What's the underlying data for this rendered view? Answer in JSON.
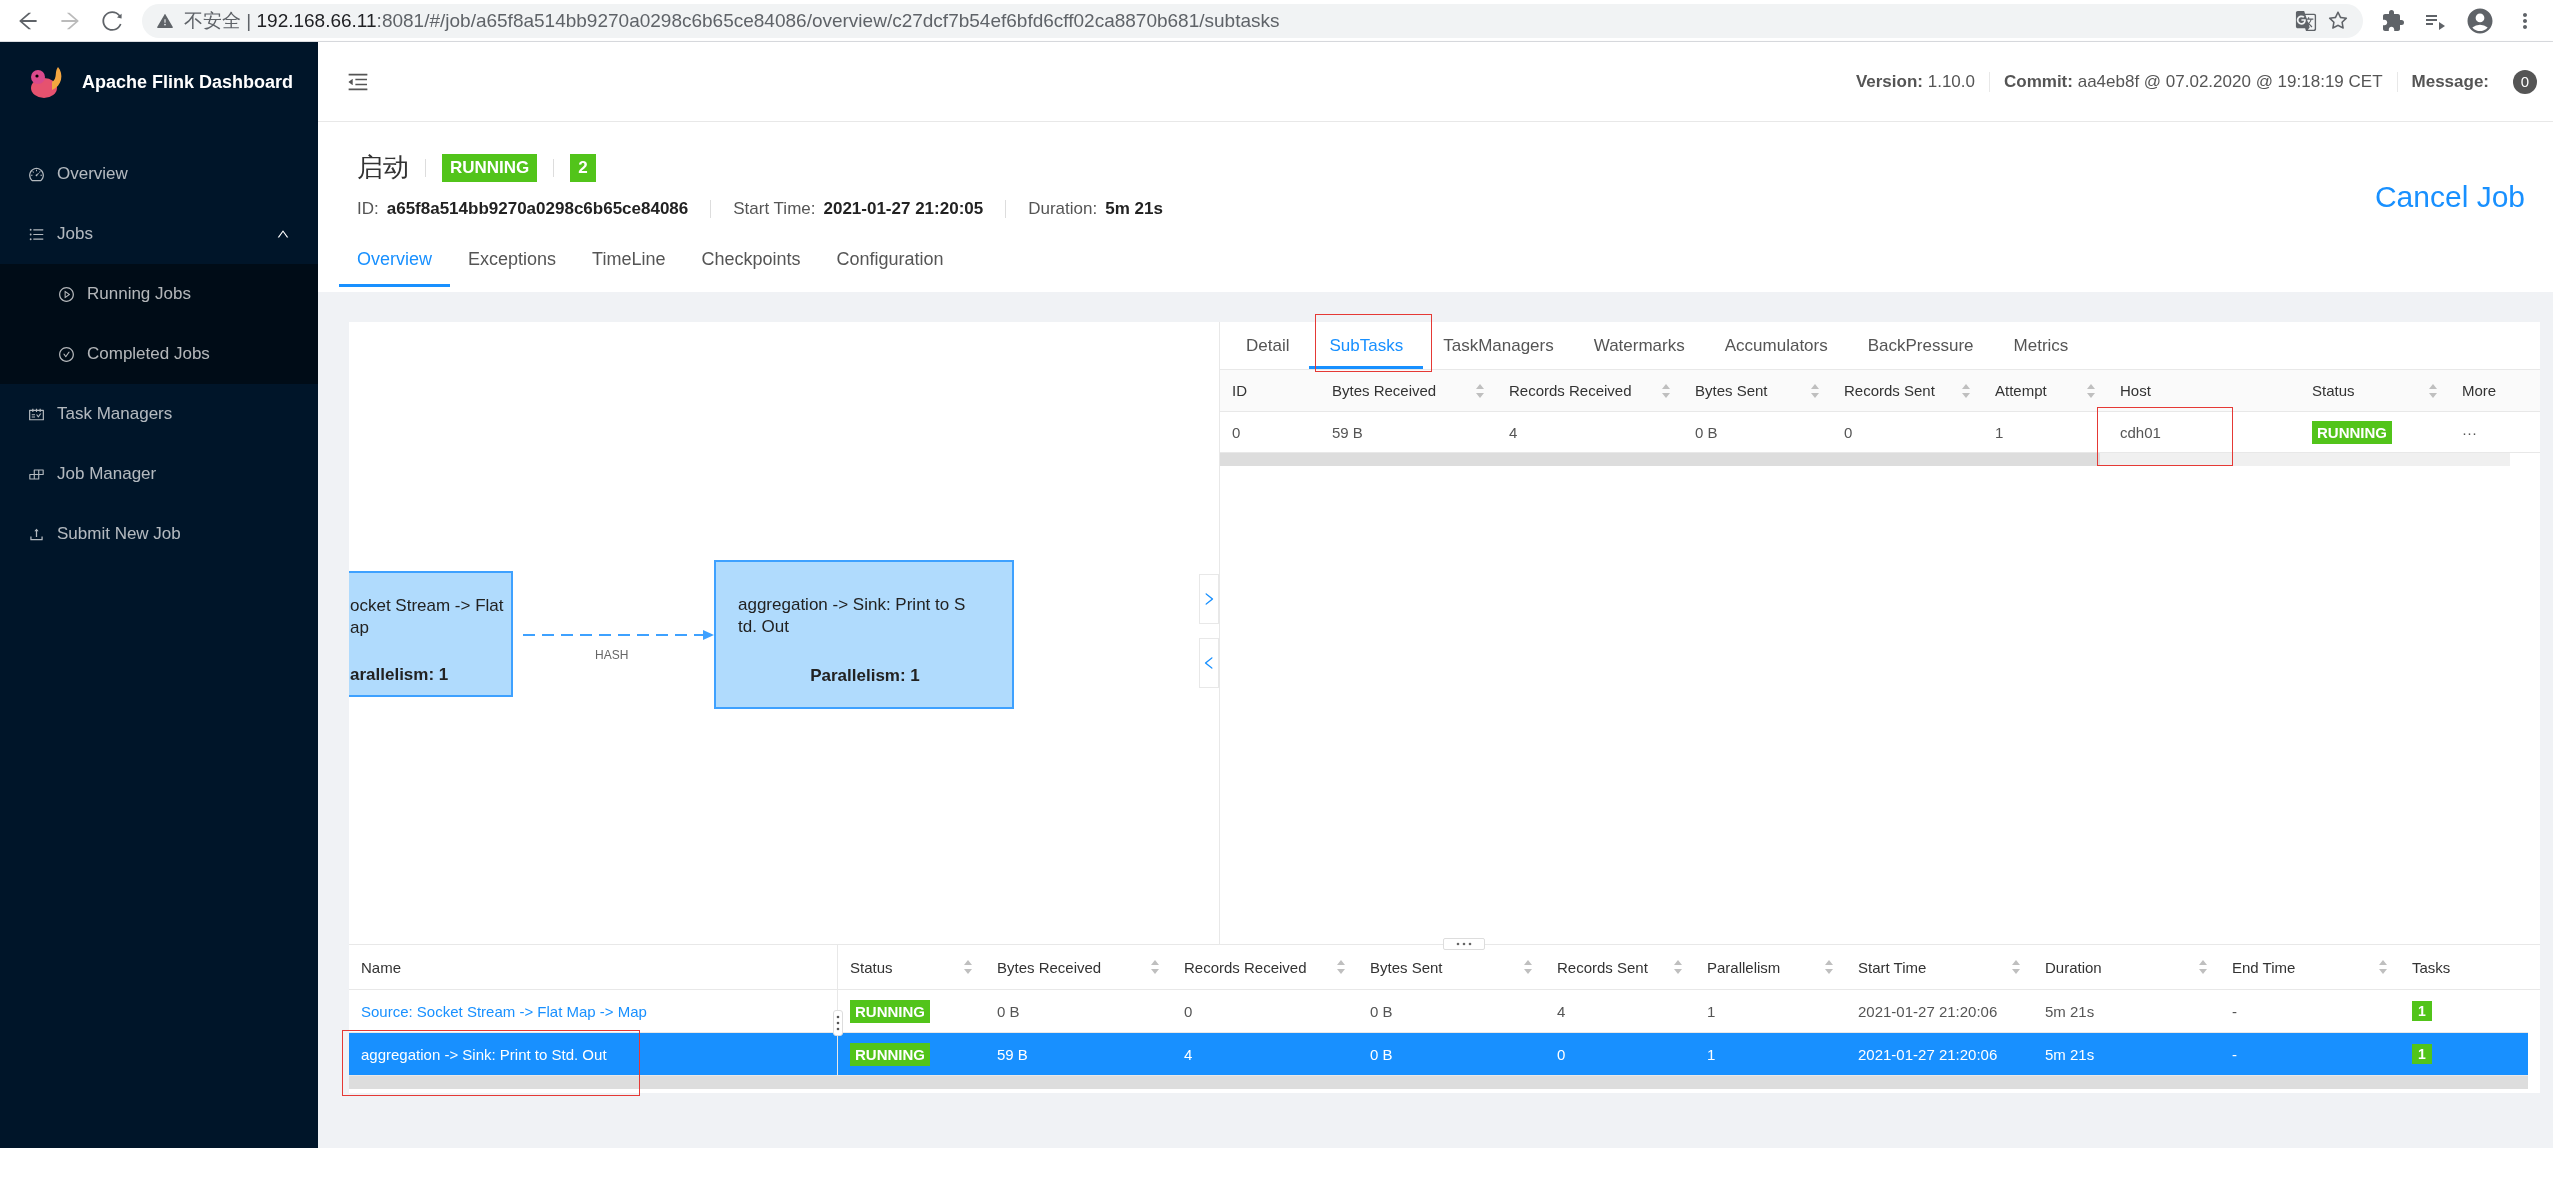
{
  "browser": {
    "security": "不安全",
    "separator": "|",
    "host": "192.168.66.11",
    "path": ":8081/#/job/a65f8a514bb9270a0298c6b65ce84086/overview/c27dcf7b54ef6bfd6cff02ca8870b681/subtasks"
  },
  "sidebar": {
    "title": "Apache Flink Dashboard",
    "items": [
      {
        "label": "Overview"
      },
      {
        "label": "Jobs",
        "expanded": true,
        "children": [
          {
            "label": "Running Jobs"
          },
          {
            "label": "Completed Jobs"
          }
        ]
      },
      {
        "label": "Task Managers"
      },
      {
        "label": "Job Manager"
      },
      {
        "label": "Submit New Job"
      }
    ]
  },
  "header": {
    "version_label": "Version:",
    "version": "1.10.0",
    "commit_label": "Commit:",
    "commit": "aa4eb8f @ 07.02.2020 @ 19:18:19 CET",
    "message_label": "Message:",
    "message_count": "0"
  },
  "job": {
    "name": "启动",
    "status": "RUNNING",
    "count": "2",
    "id_label": "ID:",
    "id": "a65f8a514bb9270a0298c6b65ce84086",
    "start_label": "Start Time:",
    "start": "2021-01-27 21:20:05",
    "duration_label": "Duration:",
    "duration": "5m 21s",
    "cancel": "Cancel Job",
    "tabs": [
      {
        "label": "Overview",
        "selected": true
      },
      {
        "label": "Exceptions",
        "selected": false
      },
      {
        "label": "TimeLine",
        "selected": false
      },
      {
        "label": "Checkpoints",
        "selected": false
      },
      {
        "label": "Configuration",
        "selected": false
      }
    ]
  },
  "graph": {
    "nodes": [
      {
        "lines": [
          "ocket Stream -> Flat",
          "ap"
        ],
        "parallelism": "arallelism: 1"
      },
      {
        "lines": [
          "aggregation -> Sink: Print to S",
          "td. Out"
        ],
        "parallelism": "Parallelism: 1"
      }
    ],
    "edge_label": "HASH"
  },
  "detail": {
    "tabs": [
      {
        "label": "Detail",
        "selected": false
      },
      {
        "label": "SubTasks",
        "selected": true
      },
      {
        "label": "TaskManagers",
        "selected": false
      },
      {
        "label": "Watermarks",
        "selected": false
      },
      {
        "label": "Accumulators",
        "selected": false
      },
      {
        "label": "BackPressure",
        "selected": false
      },
      {
        "label": "Metrics",
        "selected": false
      }
    ],
    "columns": [
      {
        "label": "ID",
        "sortable": false
      },
      {
        "label": "Bytes Received",
        "sortable": true
      },
      {
        "label": "Records Received",
        "sortable": true
      },
      {
        "label": "Bytes Sent",
        "sortable": true
      },
      {
        "label": "Records Sent",
        "sortable": true
      },
      {
        "label": "Attempt",
        "sortable": true
      },
      {
        "label": "Host",
        "sortable": false
      },
      {
        "label": "Status",
        "sortable": true
      },
      {
        "label": "More",
        "sortable": false
      }
    ],
    "rows": [
      {
        "cells": [
          "0",
          "59 B",
          "4",
          "0 B",
          "0",
          "1",
          "cdh01",
          "RUNNING",
          "···"
        ]
      }
    ]
  },
  "vertices": {
    "columns": [
      {
        "label": "Name",
        "sortable": false
      },
      {
        "label": "Status",
        "sortable": true
      },
      {
        "label": "Bytes Received",
        "sortable": true
      },
      {
        "label": "Records Received",
        "sortable": true
      },
      {
        "label": "Bytes Sent",
        "sortable": true
      },
      {
        "label": "Records Sent",
        "sortable": true
      },
      {
        "label": "Parallelism",
        "sortable": true
      },
      {
        "label": "Start Time",
        "sortable": true
      },
      {
        "label": "Duration",
        "sortable": true
      },
      {
        "label": "End Time",
        "sortable": true
      },
      {
        "label": "Tasks",
        "sortable": false
      }
    ],
    "rows": [
      {
        "cells": [
          "Source: Socket Stream -> Flat Map -> Map",
          "RUNNING",
          "0 B",
          "0",
          "0 B",
          "4",
          "1",
          "2021-01-27 21:20:06",
          "5m 21s",
          "-",
          "1"
        ],
        "selected": false
      },
      {
        "cells": [
          "aggregation -> Sink: Print to Std. Out",
          "RUNNING",
          "59 B",
          "4",
          "0 B",
          "0",
          "1",
          "2021-01-27 21:20:06",
          "5m 21s",
          "-",
          "1"
        ],
        "selected": true
      }
    ]
  }
}
